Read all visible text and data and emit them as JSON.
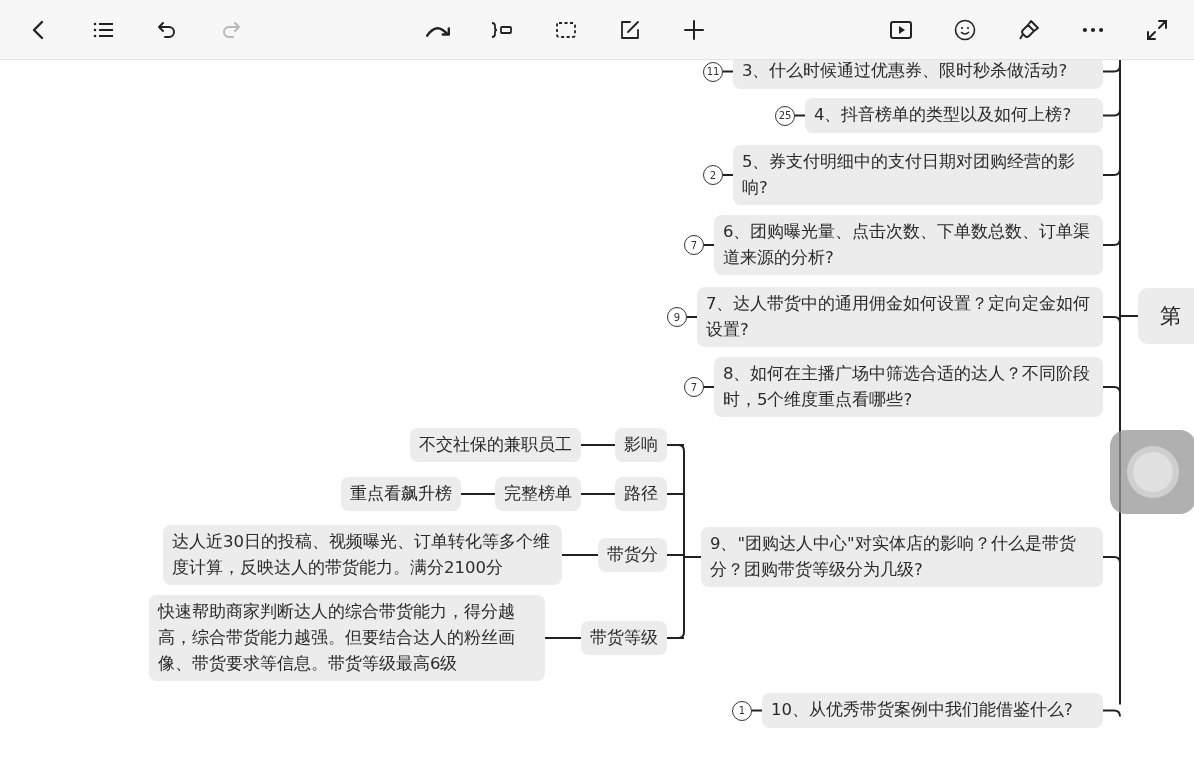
{
  "toolbar": {
    "left": [
      {
        "kind": "back",
        "disabled": false
      },
      {
        "kind": "outline",
        "disabled": false
      },
      {
        "kind": "undo",
        "disabled": false
      },
      {
        "kind": "redo",
        "disabled": true
      }
    ],
    "center": [
      {
        "kind": "relationship",
        "disabled": false
      },
      {
        "kind": "summary",
        "disabled": false
      },
      {
        "kind": "boundary",
        "disabled": false
      },
      {
        "kind": "note",
        "disabled": false
      },
      {
        "kind": "add",
        "disabled": false
      }
    ],
    "right": [
      {
        "kind": "present",
        "disabled": false
      },
      {
        "kind": "sticker",
        "disabled": false
      },
      {
        "kind": "format",
        "disabled": false
      },
      {
        "kind": "more",
        "disabled": false
      },
      {
        "kind": "fullscreen",
        "disabled": false
      }
    ]
  },
  "mindmap": {
    "central_topic": "第",
    "topics": [
      {
        "text": "3、什么时候通过优惠券、限时秒杀做活动?",
        "collapsed_count": "11"
      },
      {
        "text": "4、抖音榜单的类型以及如何上榜?",
        "collapsed_count": "25"
      },
      {
        "text": "5、券支付明细中的支付日期对团购经营的影响?",
        "collapsed_count": "2"
      },
      {
        "text": "6、团购曝光量、点击次数、下单数总数、订单渠道来源的分析?",
        "collapsed_count": "7"
      },
      {
        "text": "7、达人带货中的通用佣金如何设置？定向定金如何设置?",
        "collapsed_count": "9"
      },
      {
        "text": "8、如何在主播广场中筛选合适的达人？不同阶段时，5个维度重点看哪些?",
        "collapsed_count": "7"
      },
      {
        "text": "9、\"团购达人中心\"对实体店的影响？什么是带货分？团购带货等级分为几级?",
        "children": [
          {
            "text": "影响",
            "children": [
              {
                "text": "不交社保的兼职员工"
              }
            ]
          },
          {
            "text": "路径",
            "children": [
              {
                "text": "完整榜单",
                "children": [
                  {
                    "text": "重点看飙升榜"
                  }
                ]
              }
            ]
          },
          {
            "text": "带货分",
            "children": [
              {
                "text": "达人近30日的投稿、视频曝光、订单转化等多个维度计算，反映达人的带货能力。满分2100分"
              }
            ]
          },
          {
            "text": "带货等级",
            "children": [
              {
                "text": "快速帮助商家判断达人的综合带货能力，得分越高，综合带货能力越强。但要结合达人的粉丝画像、带货要求等信息。带货等级最高6级"
              }
            ]
          }
        ]
      },
      {
        "text": "10、从优秀带货案例中我们能借鉴什么?",
        "collapsed_count": "1"
      }
    ]
  }
}
